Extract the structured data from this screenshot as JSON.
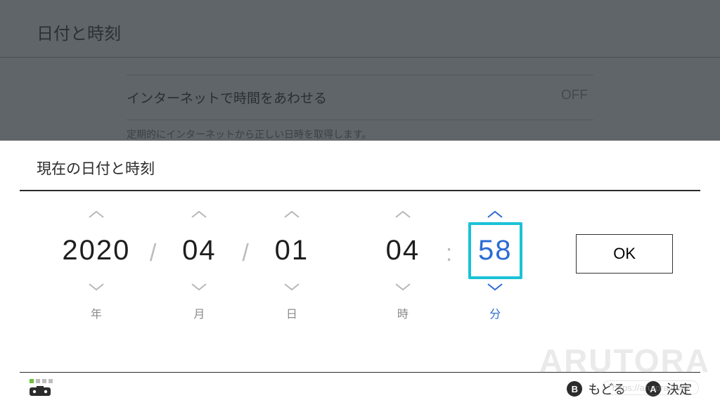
{
  "header": {
    "title": "日付と時刻"
  },
  "background_setting": {
    "label": "インターネットで時間をあわせる",
    "value": "OFF",
    "helper": "定期的にインターネットから正しい日時を取得します。"
  },
  "modal": {
    "title": "現在の日付と時刻",
    "spinners": {
      "year": {
        "value": "2020",
        "label": "年"
      },
      "month": {
        "value": "04",
        "label": "月"
      },
      "day": {
        "value": "01",
        "label": "日"
      },
      "hour": {
        "value": "04",
        "label": "時"
      },
      "minute": {
        "value": "58",
        "label": "分"
      }
    },
    "separators": {
      "date": "/",
      "time": ":"
    },
    "ok_label": "OK",
    "active_field": "minute"
  },
  "bottom": {
    "back": {
      "button": "B",
      "label": "もどる"
    },
    "confirm": {
      "button": "A",
      "label": "決定"
    }
  },
  "watermark": {
    "text": "ARUTORA",
    "url": "https://arutora.com"
  },
  "colors": {
    "accent_cyan": "#1bc2d6",
    "accent_blue": "#2a6bd4",
    "overlay": "rgba(40,48,54,0.72)"
  }
}
